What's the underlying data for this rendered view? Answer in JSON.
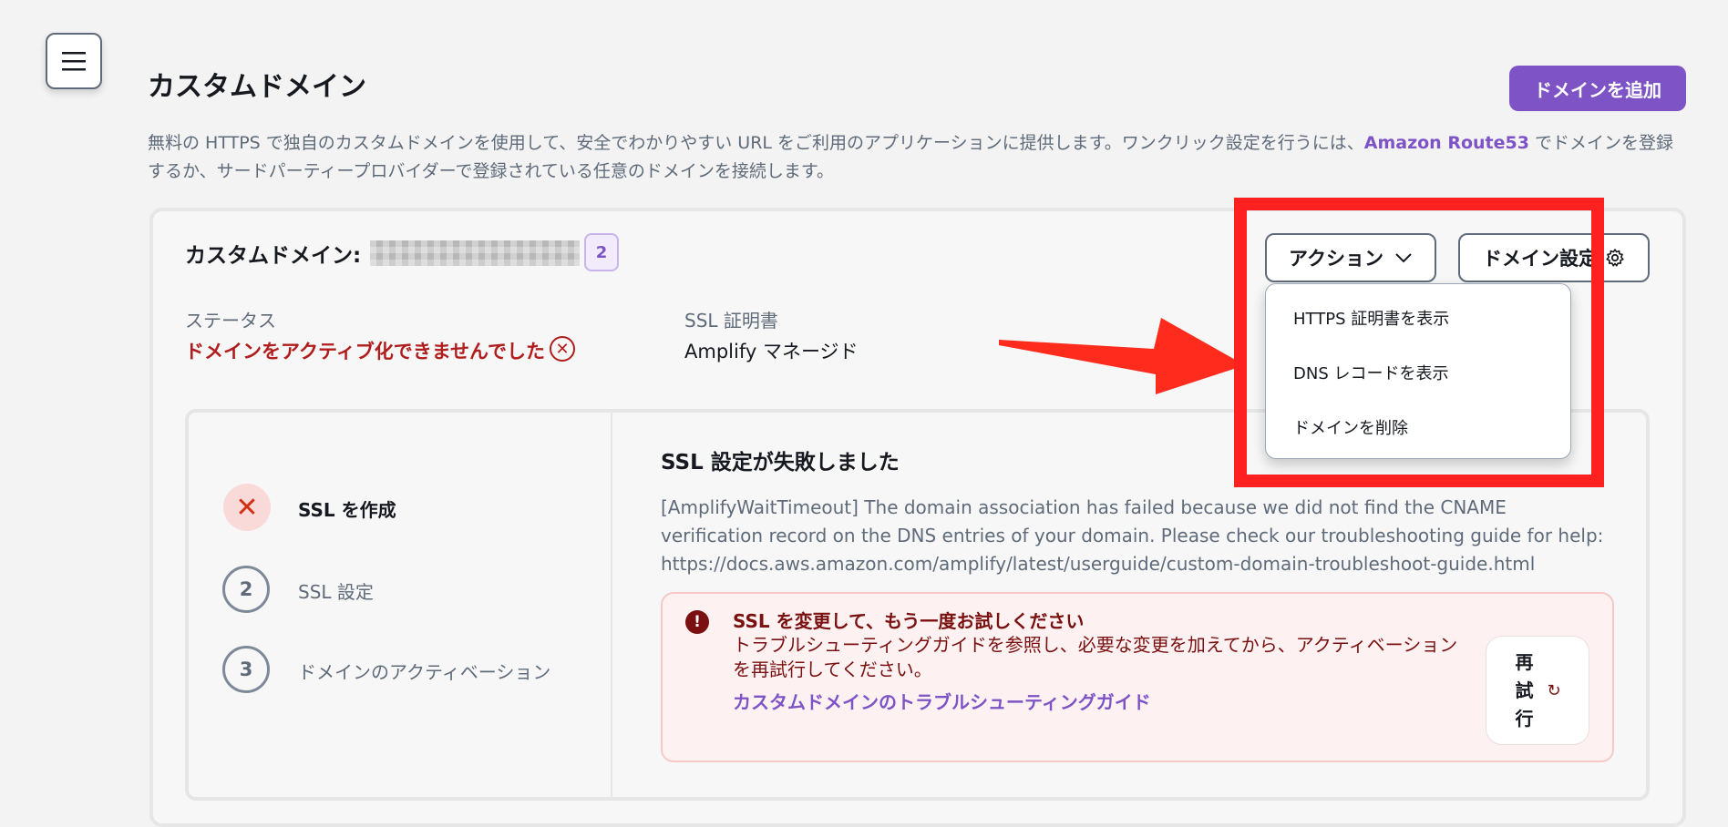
{
  "header": {
    "title": "カスタムドメイン",
    "add_domain_label": "ドメインを追加",
    "description_prefix": "無料の HTTPS で独自のカスタムドメインを使用して、安全でわかりやすい URL をご利用のアプリケーションに提供します。ワンクリック設定を行うには、",
    "description_link": "Amazon Route53",
    "description_suffix": " でドメインを登録するか、サードパーティープロバイダーで登録されている任意のドメインを接続します。"
  },
  "domain_card": {
    "label": "カスタムドメイン:",
    "count": "2",
    "status_label": "ステータス",
    "status_value": "ドメインをアクティブ化できませんでした",
    "ssl_label": "SSL 証明書",
    "ssl_value": "Amplify マネージド",
    "actions_label": "アクション",
    "domain_settings_label": "ドメイン設定"
  },
  "actions_menu": {
    "items": [
      {
        "label": "HTTPS 証明書を表示"
      },
      {
        "label": "DNS レコードを表示"
      },
      {
        "label": "ドメインを削除"
      }
    ]
  },
  "steps": [
    {
      "marker": "✕",
      "label": "SSL を作成",
      "state": "failed"
    },
    {
      "marker": "2",
      "label": "SSL 設定",
      "state": "pending"
    },
    {
      "marker": "3",
      "label": "ドメインのアクティベーション",
      "state": "pending"
    }
  ],
  "error": {
    "title": "SSL 設定が失敗しました",
    "body": "[AmplifyWaitTimeout] The domain association has failed because we did not find the CNAME verification record on the DNS entries of your domain. Please check our troubleshooting guide for help: https://docs.aws.amazon.com/amplify/latest/userguide/custom-domain-troubleshoot-guide.html"
  },
  "alert": {
    "title": "SSL を変更して、もう一度お試しください",
    "body": "トラブルシューティングガイドを参照し、必要な変更を加えてから、アクティベーションを再試行してください。",
    "link": "カスタムドメインのトラブルシューティングガイド",
    "retry_label": "再試行"
  },
  "colors": {
    "accent": "#7d53c6",
    "error": "#b11d1d",
    "highlight": "#ff2020"
  }
}
